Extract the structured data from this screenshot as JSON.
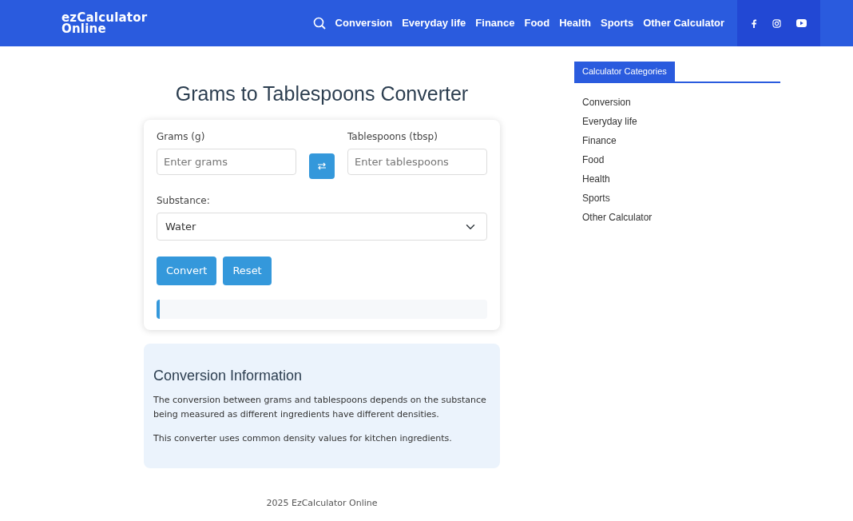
{
  "header": {
    "logo_line_1": "ezCalculator",
    "logo_line_2": "Online",
    "nav": [
      "Conversion",
      "Everyday life",
      "Finance",
      "Food",
      "Health",
      "Sports",
      "Other Calculator"
    ]
  },
  "page_title": "Grams to Tablespoons Converter",
  "converter": {
    "from": {
      "label": "Grams (g)",
      "placeholder": "Enter grams"
    },
    "to": {
      "label": "Tablespoons (tbsp)",
      "placeholder": "Enter tablespoons"
    },
    "substance_label": "Substance:",
    "substance": "Water",
    "buttons": [
      "Convert",
      "Reset"
    ]
  },
  "info": {
    "title": "Conversion Information",
    "paragraphs": [
      "The conversion between grams and tablespoons depends on the substance being measured as different ingredients have different densities.",
      "This converter uses common density values for kitchen ingredients."
    ]
  },
  "sidebar": {
    "title": "Calculator Categories",
    "items": [
      "Conversion",
      "Everyday life",
      "Finance",
      "Food",
      "Health",
      "Sports",
      "Other Calculator"
    ]
  },
  "footer": "2025 EzCalculator Online"
}
